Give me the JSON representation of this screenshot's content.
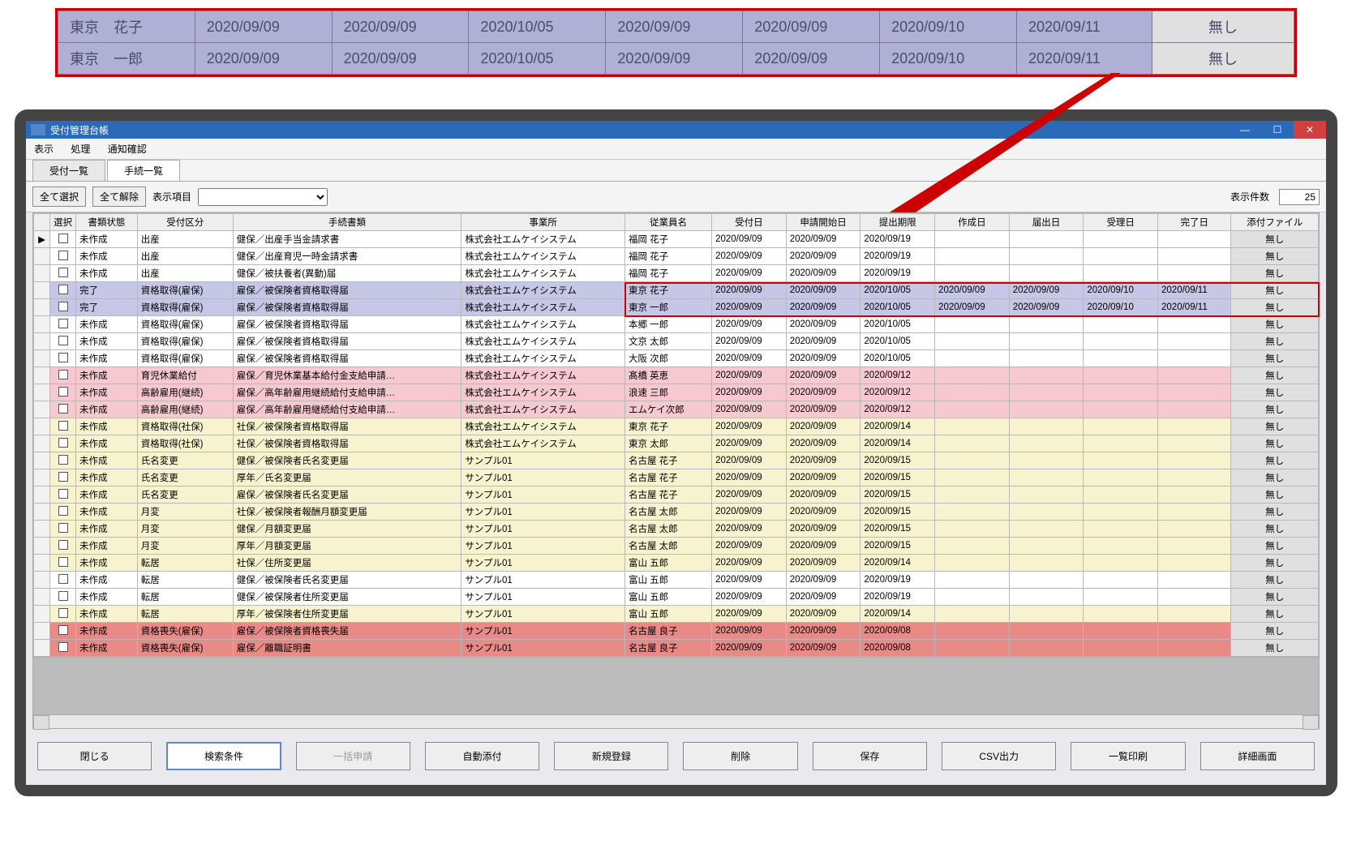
{
  "callout": {
    "rows": [
      {
        "name": "東京　花子",
        "d1": "2020/09/09",
        "d2": "2020/09/09",
        "d3": "2020/10/05",
        "d4": "2020/09/09",
        "d5": "2020/09/09",
        "d6": "2020/09/10",
        "d7": "2020/09/11",
        "btn": "無し"
      },
      {
        "name": "東京　一郎",
        "d1": "2020/09/09",
        "d2": "2020/09/09",
        "d3": "2020/10/05",
        "d4": "2020/09/09",
        "d5": "2020/09/09",
        "d6": "2020/09/10",
        "d7": "2020/09/11",
        "btn": "無し"
      }
    ]
  },
  "window": {
    "title": "受付管理台帳"
  },
  "menu": {
    "m1": "表示",
    "m2": "処理",
    "m3": "通知確認"
  },
  "tabs": {
    "t1": "受付一覧",
    "t2": "手続一覧"
  },
  "toolbar": {
    "select_all": "全て選択",
    "clear_all": "全て解除",
    "display_items": "表示項目",
    "count_label": "表示件数",
    "count": "25"
  },
  "columns": {
    "c0": "",
    "c1": "選択",
    "c2": "書類状態",
    "c3": "受付区分",
    "c4": "手続書類",
    "c5": "事業所",
    "c6": "従業員名",
    "c7": "受付日",
    "c8": "申請開始日",
    "c9": "提出期限",
    "c10": "作成日",
    "c11": "届出日",
    "c12": "受理日",
    "c13": "完了日",
    "c14": "添付ファイル"
  },
  "rows": [
    {
      "tint": "plain",
      "cur": "▶",
      "status": "未作成",
      "class": "出産",
      "doc": "健保／出産手当金請求書",
      "office": "株式会社エムケイシステム",
      "emp": "福岡 花子",
      "d1": "2020/09/09",
      "d2": "2020/09/09",
      "d3": "2020/09/19",
      "d4": "",
      "d5": "",
      "d6": "",
      "d7": "",
      "att": "無し"
    },
    {
      "tint": "plain",
      "status": "未作成",
      "class": "出産",
      "doc": "健保／出産育児一時金請求書",
      "office": "株式会社エムケイシステム",
      "emp": "福岡 花子",
      "d1": "2020/09/09",
      "d2": "2020/09/09",
      "d3": "2020/09/19",
      "d4": "",
      "d5": "",
      "d6": "",
      "d7": "",
      "att": "無し"
    },
    {
      "tint": "plain",
      "status": "未作成",
      "class": "出産",
      "doc": "健保／被扶養者(異動)届",
      "office": "株式会社エムケイシステム",
      "emp": "福岡 花子",
      "d1": "2020/09/09",
      "d2": "2020/09/09",
      "d3": "2020/09/19",
      "d4": "",
      "d5": "",
      "d6": "",
      "d7": "",
      "att": "無し"
    },
    {
      "tint": "purple",
      "status": "完了",
      "class": "資格取得(雇保)",
      "doc": "雇保／被保険者資格取得届",
      "office": "株式会社エムケイシステム",
      "emp": "東京 花子",
      "d1": "2020/09/09",
      "d2": "2020/09/09",
      "d3": "2020/10/05",
      "d4": "2020/09/09",
      "d5": "2020/09/09",
      "d6": "2020/09/10",
      "d7": "2020/09/11",
      "att": "無し"
    },
    {
      "tint": "purple",
      "status": "完了",
      "class": "資格取得(雇保)",
      "doc": "雇保／被保険者資格取得届",
      "office": "株式会社エムケイシステム",
      "emp": "東京 一郎",
      "d1": "2020/09/09",
      "d2": "2020/09/09",
      "d3": "2020/10/05",
      "d4": "2020/09/09",
      "d5": "2020/09/09",
      "d6": "2020/09/10",
      "d7": "2020/09/11",
      "att": "無し"
    },
    {
      "tint": "plain",
      "status": "未作成",
      "class": "資格取得(雇保)",
      "doc": "雇保／被保険者資格取得届",
      "office": "株式会社エムケイシステム",
      "emp": "本郷 一郎",
      "d1": "2020/09/09",
      "d2": "2020/09/09",
      "d3": "2020/10/05",
      "d4": "",
      "d5": "",
      "d6": "",
      "d7": "",
      "att": "無し"
    },
    {
      "tint": "plain",
      "status": "未作成",
      "class": "資格取得(雇保)",
      "doc": "雇保／被保険者資格取得届",
      "office": "株式会社エムケイシステム",
      "emp": "文京 太郎",
      "d1": "2020/09/09",
      "d2": "2020/09/09",
      "d3": "2020/10/05",
      "d4": "",
      "d5": "",
      "d6": "",
      "d7": "",
      "att": "無し"
    },
    {
      "tint": "plain",
      "status": "未作成",
      "class": "資格取得(雇保)",
      "doc": "雇保／被保険者資格取得届",
      "office": "株式会社エムケイシステム",
      "emp": "大阪 次郎",
      "d1": "2020/09/09",
      "d2": "2020/09/09",
      "d3": "2020/10/05",
      "d4": "",
      "d5": "",
      "d6": "",
      "d7": "",
      "att": "無し"
    },
    {
      "tint": "pink",
      "status": "未作成",
      "class": "育児休業給付",
      "doc": "雇保／育児休業基本給付金支給申請…",
      "office": "株式会社エムケイシステム",
      "emp": "髙橋 英恵",
      "d1": "2020/09/09",
      "d2": "2020/09/09",
      "d3": "2020/09/12",
      "d4": "",
      "d5": "",
      "d6": "",
      "d7": "",
      "att": "無し"
    },
    {
      "tint": "pink",
      "status": "未作成",
      "class": "高齢雇用(継続)",
      "doc": "雇保／高年齢雇用継続給付支給申請…",
      "office": "株式会社エムケイシステム",
      "emp": "浪速 三郎",
      "d1": "2020/09/09",
      "d2": "2020/09/09",
      "d3": "2020/09/12",
      "d4": "",
      "d5": "",
      "d6": "",
      "d7": "",
      "att": "無し"
    },
    {
      "tint": "pink",
      "status": "未作成",
      "class": "高齢雇用(継続)",
      "doc": "雇保／高年齢雇用継続給付支給申請…",
      "office": "株式会社エムケイシステム",
      "emp": "エムケイ次郎",
      "d1": "2020/09/09",
      "d2": "2020/09/09",
      "d3": "2020/09/12",
      "d4": "",
      "d5": "",
      "d6": "",
      "d7": "",
      "att": "無し"
    },
    {
      "tint": "cream",
      "status": "未作成",
      "class": "資格取得(社保)",
      "doc": "社保／被保険者資格取得届",
      "office": "株式会社エムケイシステム",
      "emp": "東京 花子",
      "d1": "2020/09/09",
      "d2": "2020/09/09",
      "d3": "2020/09/14",
      "d4": "",
      "d5": "",
      "d6": "",
      "d7": "",
      "att": "無し"
    },
    {
      "tint": "cream",
      "status": "未作成",
      "class": "資格取得(社保)",
      "doc": "社保／被保険者資格取得届",
      "office": "株式会社エムケイシステム",
      "emp": "東京 太郎",
      "d1": "2020/09/09",
      "d2": "2020/09/09",
      "d3": "2020/09/14",
      "d4": "",
      "d5": "",
      "d6": "",
      "d7": "",
      "att": "無し"
    },
    {
      "tint": "cream",
      "status": "未作成",
      "class": "氏名変更",
      "doc": "健保／被保険者氏名変更届",
      "office": "サンプル01",
      "emp": "名古屋 花子",
      "d1": "2020/09/09",
      "d2": "2020/09/09",
      "d3": "2020/09/15",
      "d4": "",
      "d5": "",
      "d6": "",
      "d7": "",
      "att": "無し"
    },
    {
      "tint": "cream",
      "status": "未作成",
      "class": "氏名変更",
      "doc": "厚年／氏名変更届",
      "office": "サンプル01",
      "emp": "名古屋 花子",
      "d1": "2020/09/09",
      "d2": "2020/09/09",
      "d3": "2020/09/15",
      "d4": "",
      "d5": "",
      "d6": "",
      "d7": "",
      "att": "無し"
    },
    {
      "tint": "cream",
      "status": "未作成",
      "class": "氏名変更",
      "doc": "雇保／被保険者氏名変更届",
      "office": "サンプル01",
      "emp": "名古屋 花子",
      "d1": "2020/09/09",
      "d2": "2020/09/09",
      "d3": "2020/09/15",
      "d4": "",
      "d5": "",
      "d6": "",
      "d7": "",
      "att": "無し"
    },
    {
      "tint": "cream",
      "status": "未作成",
      "class": "月変",
      "doc": "社保／被保険者報酬月額変更届",
      "office": "サンプル01",
      "emp": "名古屋 太郎",
      "d1": "2020/09/09",
      "d2": "2020/09/09",
      "d3": "2020/09/15",
      "d4": "",
      "d5": "",
      "d6": "",
      "d7": "",
      "att": "無し"
    },
    {
      "tint": "cream",
      "status": "未作成",
      "class": "月変",
      "doc": "健保／月額変更届",
      "office": "サンプル01",
      "emp": "名古屋 太郎",
      "d1": "2020/09/09",
      "d2": "2020/09/09",
      "d3": "2020/09/15",
      "d4": "",
      "d5": "",
      "d6": "",
      "d7": "",
      "att": "無し"
    },
    {
      "tint": "cream",
      "status": "未作成",
      "class": "月変",
      "doc": "厚年／月額変更届",
      "office": "サンプル01",
      "emp": "名古屋 太郎",
      "d1": "2020/09/09",
      "d2": "2020/09/09",
      "d3": "2020/09/15",
      "d4": "",
      "d5": "",
      "d6": "",
      "d7": "",
      "att": "無し"
    },
    {
      "tint": "cream",
      "status": "未作成",
      "class": "転居",
      "doc": "社保／住所変更届",
      "office": "サンプル01",
      "emp": "富山 五郎",
      "d1": "2020/09/09",
      "d2": "2020/09/09",
      "d3": "2020/09/14",
      "d4": "",
      "d5": "",
      "d6": "",
      "d7": "",
      "att": "無し"
    },
    {
      "tint": "plain",
      "status": "未作成",
      "class": "転居",
      "doc": "健保／被保険者氏名変更届",
      "office": "サンプル01",
      "emp": "富山 五郎",
      "d1": "2020/09/09",
      "d2": "2020/09/09",
      "d3": "2020/09/19",
      "d4": "",
      "d5": "",
      "d6": "",
      "d7": "",
      "att": "無し"
    },
    {
      "tint": "plain",
      "status": "未作成",
      "class": "転居",
      "doc": "健保／被保険者住所変更届",
      "office": "サンプル01",
      "emp": "富山 五郎",
      "d1": "2020/09/09",
      "d2": "2020/09/09",
      "d3": "2020/09/19",
      "d4": "",
      "d5": "",
      "d6": "",
      "d7": "",
      "att": "無し"
    },
    {
      "tint": "cream",
      "status": "未作成",
      "class": "転居",
      "doc": "厚年／被保険者住所変更届",
      "office": "サンプル01",
      "emp": "富山 五郎",
      "d1": "2020/09/09",
      "d2": "2020/09/09",
      "d3": "2020/09/14",
      "d4": "",
      "d5": "",
      "d6": "",
      "d7": "",
      "att": "無し"
    },
    {
      "tint": "red",
      "status": "未作成",
      "class": "資格喪失(雇保)",
      "doc": "雇保／被保険者資格喪失届",
      "office": "サンプル01",
      "emp": "名古屋 良子",
      "d1": "2020/09/09",
      "d2": "2020/09/09",
      "d3": "2020/09/08",
      "d4": "",
      "d5": "",
      "d6": "",
      "d7": "",
      "att": "無し"
    },
    {
      "tint": "red",
      "status": "未作成",
      "class": "資格喪失(雇保)",
      "doc": "雇保／離職証明書",
      "office": "サンプル01",
      "emp": "名古屋 良子",
      "d1": "2020/09/09",
      "d2": "2020/09/09",
      "d3": "2020/09/08",
      "d4": "",
      "d5": "",
      "d6": "",
      "d7": "",
      "att": "無し"
    }
  ],
  "cmd": {
    "close": "閉じる",
    "search": "検索条件",
    "batch": "一括申請",
    "auto": "自動添付",
    "new": "新規登録",
    "delete": "削除",
    "save": "保存",
    "csv": "CSV出力",
    "print": "一覧印刷",
    "detail": "詳細画面"
  }
}
